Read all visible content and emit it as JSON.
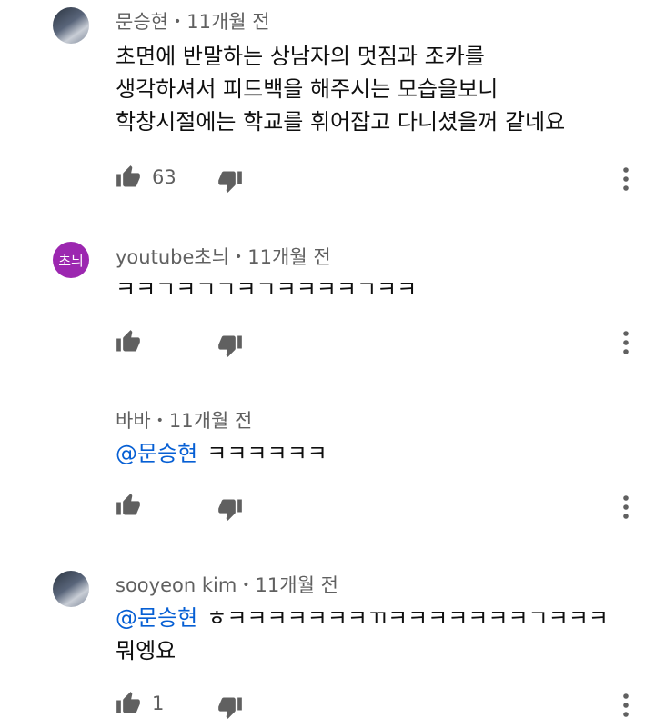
{
  "comments": [
    {
      "author": "문승현",
      "time": "11개월 전",
      "avatar_type": "photo",
      "lines": [
        "초면에 반말하는 상남자의 멋짐과 조카를",
        "생각하셔서 피드백을 해주시는 모습을보니",
        "학창시절에는 학교를 휘어잡고 다니셨을꺼 같네요"
      ],
      "likes": "63"
    },
    {
      "author": "youtube초늬",
      "time": "11개월 전",
      "avatar_type": "letter",
      "avatar_text": "초늬",
      "avatar_color": "#9c27b0",
      "lines": [
        "ㅋㅋㄱㅋㄱㄱㅋㄱㅋㅋㅋㅋㄱㅋㅋ"
      ],
      "likes": ""
    },
    {
      "author": "바바",
      "time": "11개월 전",
      "mention": "@문승현",
      "lines": [
        "ㅋㅋㅋㅋㅋㅋ"
      ],
      "likes": ""
    },
    {
      "author": "sooyeon kim",
      "time": "11개월 전",
      "avatar_type": "photo",
      "mention": "@문승현",
      "lines": [
        "ㅎㅋㅋㅋㅋㅋㅋㅋㄲㅋㅋㅋㅋㅋㅋㅋㄱㅋㅋㅋ",
        "뭐엥요"
      ],
      "likes": "1"
    }
  ],
  "separator": "•",
  "colors": {
    "meta_text": "#606060",
    "mention": "#065fd4",
    "icon": "#606060"
  },
  "icons": {
    "like": "thumb-up-icon",
    "dislike": "thumb-down-icon",
    "more": "more-vert-icon"
  }
}
